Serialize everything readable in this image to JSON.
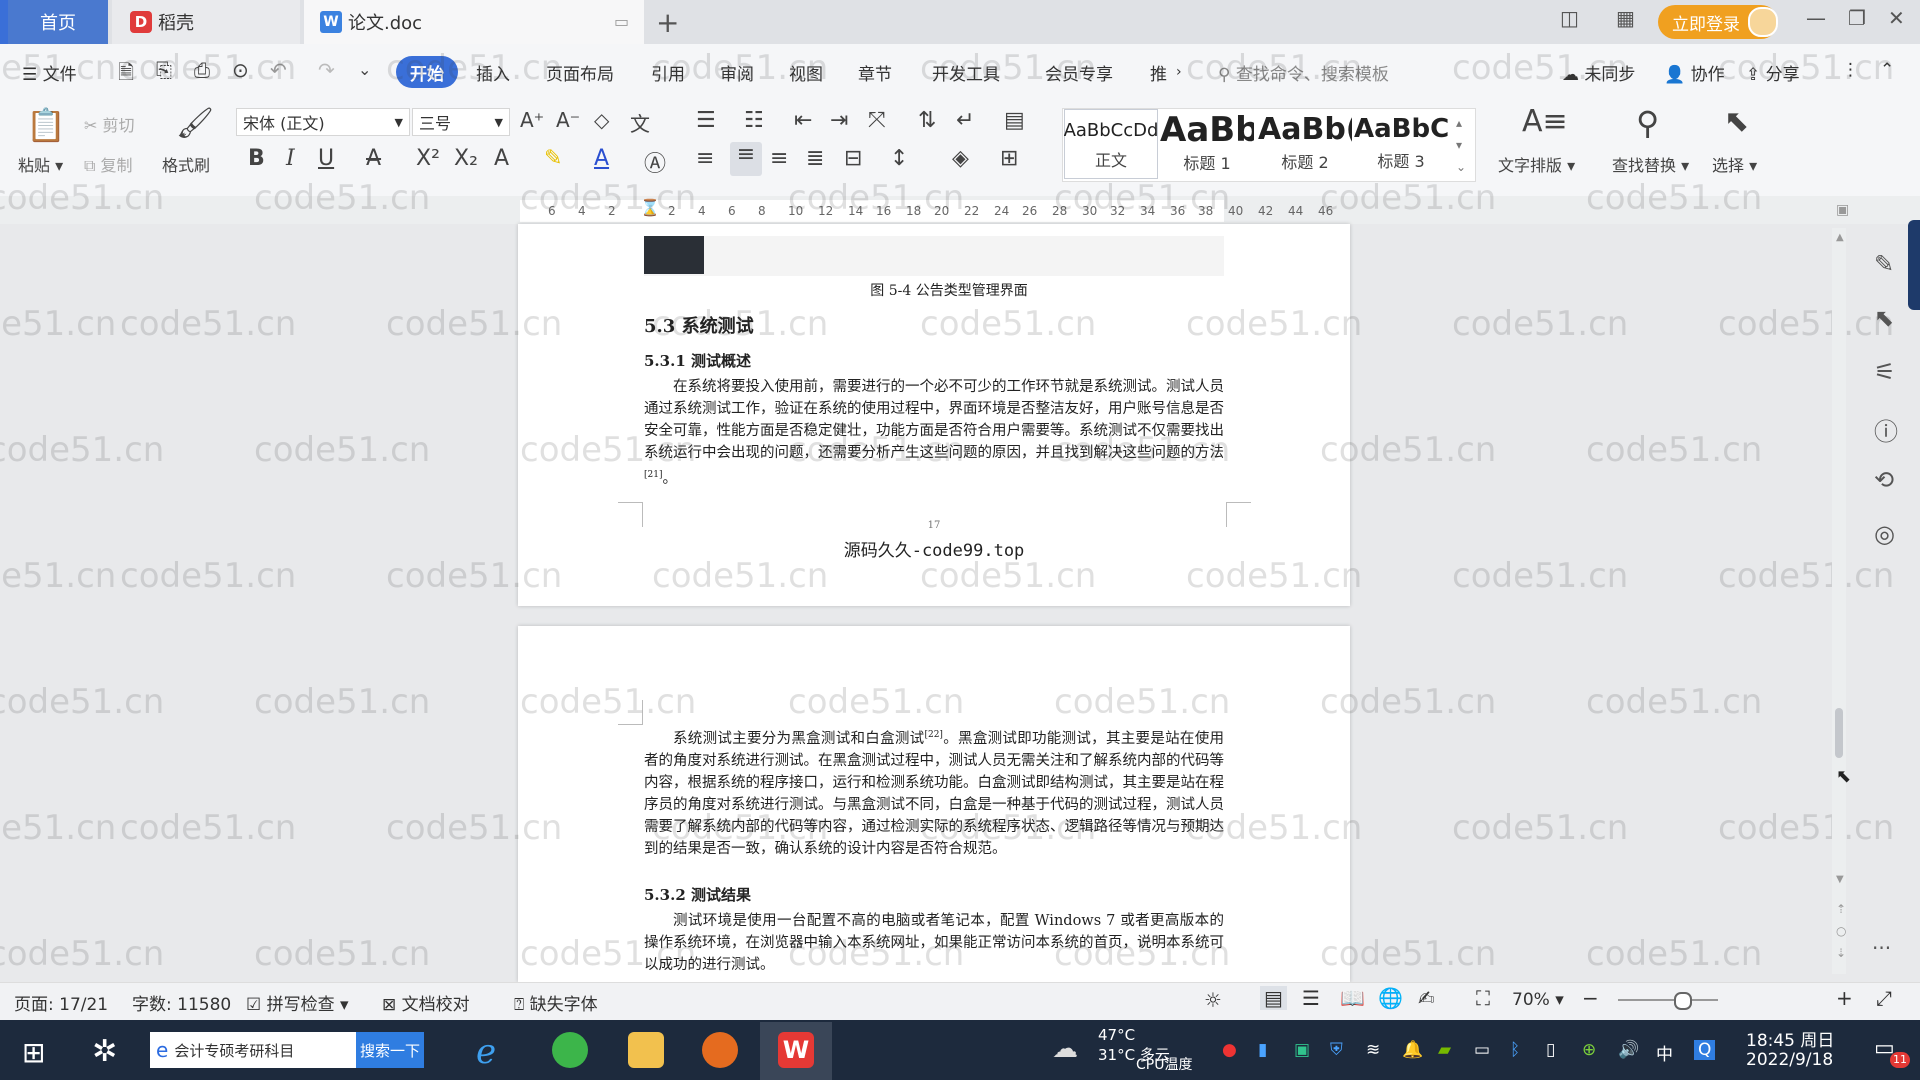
{
  "titlebar": {
    "tab_home": "首页",
    "tab_docer": "稻壳",
    "tab_doc": "论文.doc",
    "login": "立即登录"
  },
  "menubar": {
    "file": "文件",
    "items": [
      "开始",
      "插入",
      "页面布局",
      "引用",
      "审阅",
      "视图",
      "章节",
      "开发工具",
      "会员专享",
      "推"
    ],
    "search_cmd": "查找命令、搜索模板",
    "unsync": "未同步",
    "collab": "协作",
    "share": "分享"
  },
  "ribbon": {
    "paste": "粘贴",
    "cut": "剪切",
    "copy": "复制",
    "format_painter": "格式刷",
    "font_name": "宋体 (正文)",
    "font_size": "三号",
    "styles": [
      {
        "sample": "AaBbCcDd",
        "name": "正文"
      },
      {
        "sample": "AaBb",
        "name": "标题 1"
      },
      {
        "sample": "AaBb(",
        "name": "标题 2"
      },
      {
        "sample": "AaBbC",
        "name": "标题 3"
      }
    ],
    "text_layout": "文字排版",
    "find_replace": "查找替换",
    "select": "选择"
  },
  "ruler": {
    "ticks": [
      "6",
      "4",
      "2",
      "2",
      "4",
      "6",
      "8",
      "10",
      "12",
      "14",
      "16",
      "18",
      "20",
      "22",
      "24",
      "26",
      "28",
      "30",
      "32",
      "34",
      "36",
      "38",
      "40",
      "42",
      "44",
      "46"
    ]
  },
  "page1": {
    "caption": "图 5-4 公告类型管理界面",
    "heading": "5.3 系统测试",
    "subheading": "5.3.1 测试概述",
    "para1_text": "在系统将要投入使用前，需要进行的一个必不可少的工作环节就是系统测试。测试人员通过系统测试工作，验证在系统的使用过程中，界面环境是否整洁友好，用户账号信息是否安全可靠，性能方面是否稳定健壮，功能方面是否符合用户需要等。系统测试不仅需要找出系统运行中会出现的问题，还需要分析产生这些问题的原因，并且找到解决这些问题的方法",
    "para1_ref": "[21]",
    "para1_end": "。",
    "page_number": "17",
    "footer": "源码久久-code99.top"
  },
  "page2": {
    "para1_a": "系统测试主要分为黑盒测试和白盒测试",
    "para1_ref": "[22]",
    "para1_b": "。黑盒测试即功能测试，其主要是站在使用者的角度对系统进行测试。在黑盒测试过程中，测试人员无需关注和了解系统内部的代码等内容，根据系统的程序接口，运行和检测系统功能。白盒测试即结构测试，其主要是站在程序员的角度对系统进行测试。与黑盒测试不同，白盒是一种基于代码的测试过程，测试人员需要了解系统内部的代码等内容，通过检测实际的系统程序状态、逻辑路径等情况与预期达到的结果是否一致，确认系统的设计内容是否符合规范。",
    "subheading": "5.3.2 测试结果",
    "para2": "测试环境是使用一台配置不高的电脑或者笔记本，配置 Windows 7 或者更高版本的操作系统环境，在浏览器中输入本系统网址，如果能正常访问本系统的首页，说明本系统可以成功的进行测试。"
  },
  "watermark": "code51.cn",
  "statusbar": {
    "page": "页面: 17/21",
    "words": "字数: 11580",
    "spell": "拼写检查",
    "proof": "文档校对",
    "missing_font": "缺失字体",
    "zoom": "70%"
  },
  "taskbar": {
    "search_text": "会计专硕考研科目",
    "search_btn": "搜索一下",
    "temp": "47°C",
    "cpu": "CPU温度",
    "weather": "31°C 多云",
    "ime": "中",
    "time": "18:45 周日",
    "date": "2022/9/18",
    "notif_count": "11"
  }
}
